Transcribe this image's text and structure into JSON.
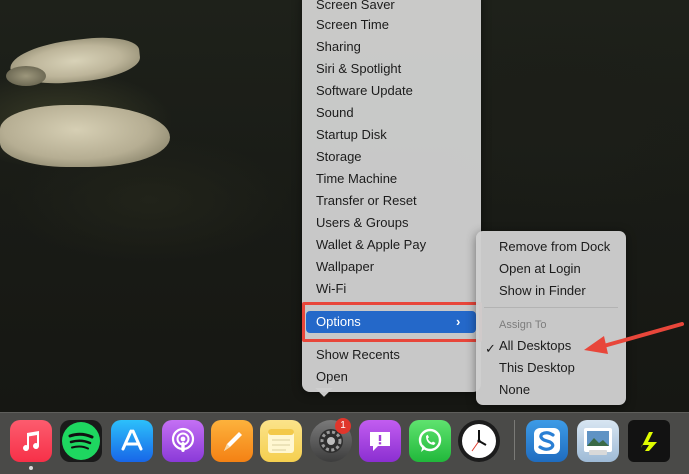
{
  "menu": {
    "items": [
      {
        "label": "Screen Saver"
      },
      {
        "label": "Screen Time"
      },
      {
        "label": "Sharing"
      },
      {
        "label": "Siri & Spotlight"
      },
      {
        "label": "Software Update"
      },
      {
        "label": "Sound"
      },
      {
        "label": "Startup Disk"
      },
      {
        "label": "Storage"
      },
      {
        "label": "Time Machine"
      },
      {
        "label": "Transfer or Reset"
      },
      {
        "label": "Users & Groups"
      },
      {
        "label": "Wallet & Apple Pay"
      },
      {
        "label": "Wallpaper"
      },
      {
        "label": "Wi-Fi"
      }
    ],
    "options_label": "Options",
    "options_chevron": "›",
    "show_recents": "Show Recents",
    "open": "Open"
  },
  "submenu": {
    "remove_from_dock": "Remove from Dock",
    "open_at_login": "Open at Login",
    "show_in_finder": "Show in Finder",
    "assign_to_header": "Assign To",
    "all_desktops": "All Desktops",
    "this_desktop": "This Desktop",
    "none": "None",
    "checkmark": "✓",
    "checked": "All Desktops"
  },
  "dock": {
    "system_settings_badge": "1",
    "apps": [
      {
        "name": "Music",
        "icon": "music-icon",
        "color": "#fb3c4e"
      },
      {
        "name": "Spotify",
        "icon": "spotify-icon",
        "color": "#1ed760"
      },
      {
        "name": "App Store",
        "icon": "app-store-icon",
        "color": "#1a8cf5"
      },
      {
        "name": "Podcasts",
        "icon": "podcasts-icon",
        "color": "#a456e0"
      },
      {
        "name": "Pages",
        "icon": "pages-icon",
        "color": "#f79a1e"
      },
      {
        "name": "Notes",
        "icon": "notes-icon",
        "color": "#f7d562"
      },
      {
        "name": "System Settings",
        "icon": "gear-icon",
        "color": "#5d5d5d"
      },
      {
        "name": "Feedback Assistant",
        "icon": "feedback-icon",
        "color": "#a23fd6"
      },
      {
        "name": "WhatsApp",
        "icon": "whatsapp-icon",
        "color": "#2fcb4f"
      },
      {
        "name": "Clock",
        "icon": "clock-icon",
        "color": "#1a1a1a"
      },
      {
        "name": "Scrivener",
        "icon": "scrivener-icon",
        "color": "#2a7fd4"
      },
      {
        "name": "Preview",
        "icon": "preview-icon",
        "color": "#8fb8de"
      },
      {
        "name": "Linear",
        "icon": "linear-icon",
        "color": "#dffc00"
      }
    ]
  },
  "annotation": {
    "highlight_color": "#e8463a",
    "arrow_color": "#e8463a"
  }
}
